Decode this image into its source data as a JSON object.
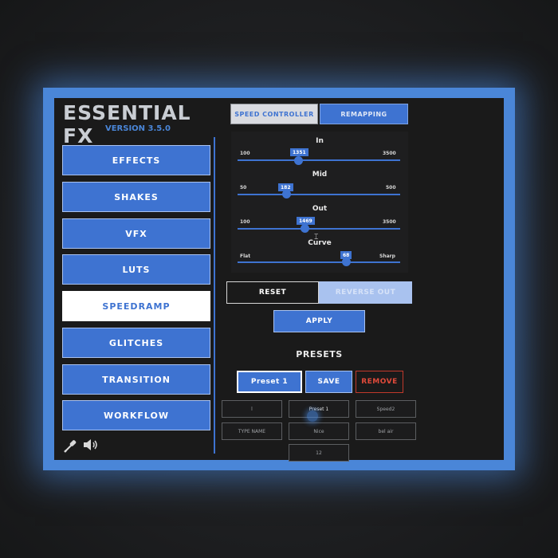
{
  "app": {
    "title": "ESSENTIAL FX",
    "version": "VERSION 3.5.0"
  },
  "nav": [
    {
      "label": "EFFECTS"
    },
    {
      "label": "SHAKES"
    },
    {
      "label": "VFX"
    },
    {
      "label": "LUTS"
    },
    {
      "label": "SPEEDRAMP"
    },
    {
      "label": "GLITCHES"
    },
    {
      "label": "TRANSITION"
    },
    {
      "label": "WORKFLOW"
    }
  ],
  "tabs": {
    "speed_controller": "SPEED CONTROLLER",
    "remapping": "REMAPPING"
  },
  "sliders": [
    {
      "label": "In",
      "min": "100",
      "max": "3500",
      "value": "1351"
    },
    {
      "label": "Mid",
      "min": "50",
      "max": "500",
      "value": "182"
    },
    {
      "label": "Out",
      "min": "100",
      "max": "3500",
      "value": "1469"
    },
    {
      "label": "Curve",
      "min": "Flat",
      "max": "Sharp",
      "value": "68"
    }
  ],
  "actions": {
    "reset": "RESET",
    "reverse_out": "REVERSE OUT",
    "apply": "APPLY"
  },
  "presets": {
    "title": "PRESETS",
    "selected": "Preset 1",
    "save": "SAVE",
    "remove": "REMOVE",
    "items": [
      "l",
      "Preset 1",
      "Speed2",
      "TYPE NAME",
      "Nice",
      "bel air",
      "12"
    ]
  },
  "icons": {
    "eyedropper": "eyedropper-icon",
    "speaker": "speaker-icon"
  },
  "colors": {
    "accent": "#3e73d1",
    "frame_glow": "#4a86d8",
    "remove": "#e04a3a"
  }
}
